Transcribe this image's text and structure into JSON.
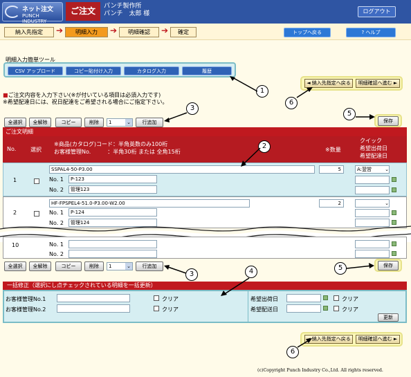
{
  "header": {
    "logo_line1": "ネット注文",
    "logo_line2": "PUNCH INDUSTRY",
    "title": "ご注文",
    "company": "パンチ製作所",
    "user": "パンチ　太郎 様",
    "logout": "ログアウト"
  },
  "steps": [
    "納入先指定",
    "明細入力",
    "明細確認",
    "確定"
  ],
  "nav": {
    "top": "トップへ戻る",
    "help": "? ヘルプ"
  },
  "tools": {
    "title": "明細入力簡単ツール",
    "buttons": [
      "CSV アップロード",
      "コピー貼付け入力",
      "カタログ入力",
      "履歴"
    ]
  },
  "navbuttons": {
    "back": "◄ 納入先指定へ戻る",
    "next": "明細確認へ進む ►"
  },
  "instructions": {
    "line1": "ご注文内容を入力下さい(※が付いている項目は必須入力です)",
    "line2": "※希望配達日には、祝日配達をご希望される場合にご指定下さい。"
  },
  "rowtools": {
    "select_all": "全選択",
    "deselect_all": "全解除",
    "copy": "コピー",
    "delete": "削除",
    "count": "1",
    "add_row": "行追加",
    "save": "保存"
  },
  "table": {
    "caption": "ご注文明細",
    "col_no": "No.",
    "col_select": "選択",
    "col_code1": "※商品(カタログ)コード：半角英数のみ100桁",
    "col_code2": "お客様管理No.　　　：半角30桁 または 全角15桁",
    "col_qty": "※数量",
    "col_quick1": "クイック",
    "col_quick2": "希望出荷日",
    "col_quick3": "希望配達日",
    "no1_label": "No. 1",
    "no2_label": "No. 2",
    "rows": [
      {
        "no": "1",
        "code": "SSPAL4-50-P3.00",
        "mgmt1": "P-123",
        "mgmt2": "管理123",
        "qty": "5",
        "quick": "A:翌営"
      },
      {
        "no": "2",
        "code": "HF-FPSPEL4-51.0-P3.00-W2.00",
        "mgmt1": "P-124",
        "mgmt2": "管理124",
        "qty": "2",
        "quick": ""
      },
      {
        "no": "10",
        "code": "",
        "mgmt1": "",
        "mgmt2": "",
        "qty": "",
        "quick": ""
      }
    ]
  },
  "bulk": {
    "title": "一括修正（選択にし点チェックされている明細を一括更新）",
    "mgmt1": "お客様管理No.1",
    "mgmt2": "お客様管理No.2",
    "clear": "クリア",
    "ship": "希望出荷日",
    "deliver": "希望配送日",
    "update": "更新"
  },
  "callouts": [
    "1",
    "2",
    "3",
    "4",
    "5",
    "6"
  ],
  "copyright": "(c)Copyright Punch Industry Co.,Ltd. All rights reserved."
}
